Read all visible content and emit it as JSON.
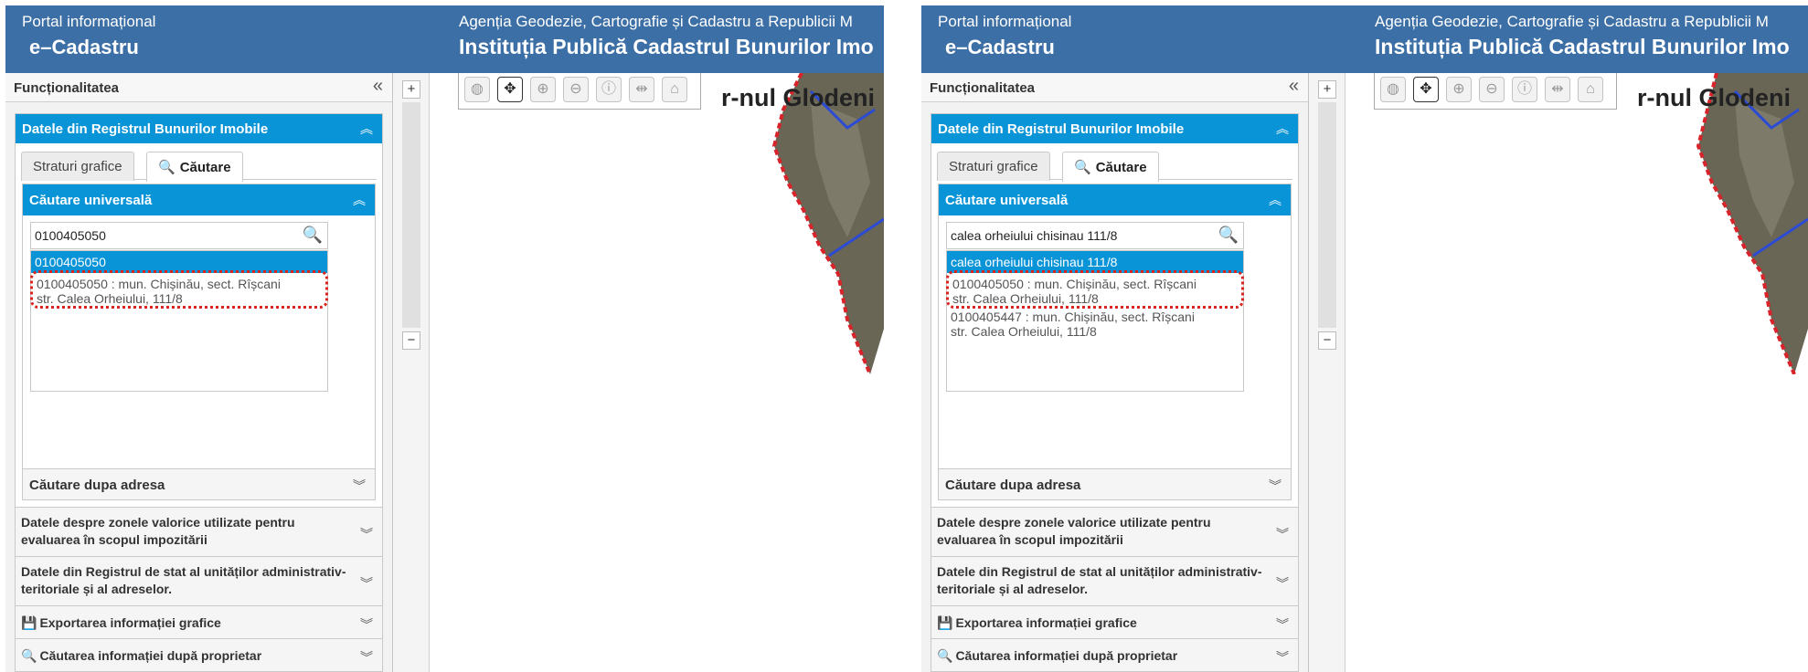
{
  "panels": [
    {
      "header": {
        "portal": "Portal informațional",
        "app": "e–Cadastru",
        "agency": "Agenția Geodezie, Cartografie și Cadastru a Republicii M",
        "institution": "Instituția Publică Cadastrul Bunurilor Imo"
      },
      "sidebar": {
        "title": "Funcționalitatea",
        "collapse_icon": "«",
        "registry": "Datele din Registrul Bunurilor Imobile",
        "tabs": [
          "Straturi grafice",
          "Căutare"
        ],
        "universal": "Căutare universală",
        "search_value": "0100405050",
        "suggestion_selected": "0100405050",
        "results": [
          {
            "line1": "0100405050 : mun. Chișinău, sect. Rîșcani",
            "line2": "str. Calea Orheiului, 111/8"
          }
        ],
        "address_search": "Căutare dupa adresa",
        "sections": [
          "Datele despre zonele valorice utilizate pentru evaluarea în scopul impozitării",
          "Datele din Registrul de stat al unităților administrativ-teritoriale și al adreselor.",
          "Exportarea informației grafice",
          "Căutarea informației după proprietar"
        ]
      },
      "map": {
        "zoom_in": "+",
        "zoom_out": "−",
        "label": "r-nul Glodeni"
      }
    },
    {
      "header": {
        "portal": "Portal informațional",
        "app": "e–Cadastru",
        "agency": "Agenția Geodezie, Cartografie și Cadastru a Republicii M",
        "institution": "Instituția Publică Cadastrul Bunurilor Imo"
      },
      "sidebar": {
        "title": "Funcționalitatea",
        "collapse_icon": "«",
        "registry": "Datele din Registrul Bunurilor Imobile",
        "tabs": [
          "Straturi grafice",
          "Căutare"
        ],
        "universal": "Căutare universală",
        "search_value": "calea orheiului chisinau 111/8",
        "suggestion_selected": "calea orheiului chisinau 111/8",
        "results": [
          {
            "line1": "0100405050 : mun. Chișinău, sect. Rîșcani",
            "line2": "str. Calea Orheiului, 111/8"
          },
          {
            "line1": "0100405447 : mun. Chișinău, sect. Rîșcani",
            "line2": "str. Calea Orheiului, 111/8"
          }
        ],
        "address_search": "Căutare dupa adresa",
        "sections": [
          "Datele despre zonele valorice utilizate pentru evaluarea în scopul impozitării",
          "Datele din Registrul de stat al unităților administrativ-teritoriale și al adreselor.",
          "Exportarea informației grafice",
          "Căutarea informației după proprietar"
        ]
      },
      "map": {
        "zoom_in": "+",
        "zoom_out": "−",
        "label": "r-nul Glodeni"
      }
    }
  ],
  "colors": {
    "header": "#3d6fa7",
    "accent": "#0a94d8",
    "highlight": "#d9231d"
  },
  "icons": [
    "search-icon",
    "globe-icon",
    "pan-icon",
    "zoom-in-icon",
    "zoom-out-icon",
    "info-icon",
    "measure-icon",
    "area-icon",
    "floppy-icon"
  ]
}
